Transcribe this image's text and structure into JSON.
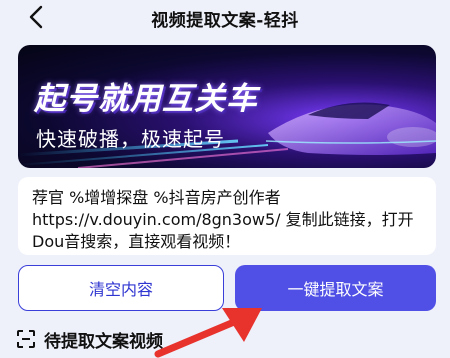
{
  "header": {
    "title": "视频提取文案-轻抖"
  },
  "banner": {
    "headline": "起号就用互关车",
    "subline": "快速破播，极速起号"
  },
  "input": {
    "partial_line": "………",
    "text": "荐官 %增增探盘 %抖音房产创作者\nhttps://v.douyin.com/8gn3ow5/ 复制此链接，打开\nDou音搜索，直接观看视频！"
  },
  "actions": {
    "clear_label": "清空内容",
    "extract_label": "一键提取文案"
  },
  "section": {
    "title": "待提取文案视频"
  },
  "colors": {
    "primary": "#5150e6",
    "primary_border": "#3a3fd9",
    "page_bg": "#eef0fa",
    "annotation_arrow": "#e8322c"
  },
  "icons": {
    "back": "chevron-left-icon",
    "section": "scan-frame-icon",
    "annotation": "red-arrow-icon"
  }
}
